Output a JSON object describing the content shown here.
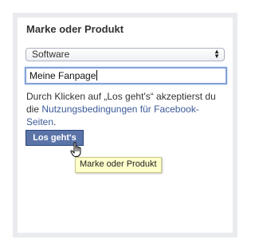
{
  "section_title": "Marke oder Produkt",
  "category_select": {
    "value": "Software"
  },
  "page_name_input": {
    "value": "Meine Fanpage"
  },
  "terms": {
    "prefix": "Durch Klicken auf „Los geht's“ akzeptierst du die ",
    "link": "Nutzungsbedingungen für Facebook-Seiten",
    "suffix": "."
  },
  "submit_label": "Los geht's",
  "tooltip": "Marke oder Produkt",
  "colors": {
    "button": "#5b74a8",
    "link": "#3b5998",
    "tooltip_bg": "#ffffcb"
  },
  "icons": [
    "select-arrows-icon",
    "hand-cursor-icon"
  ]
}
